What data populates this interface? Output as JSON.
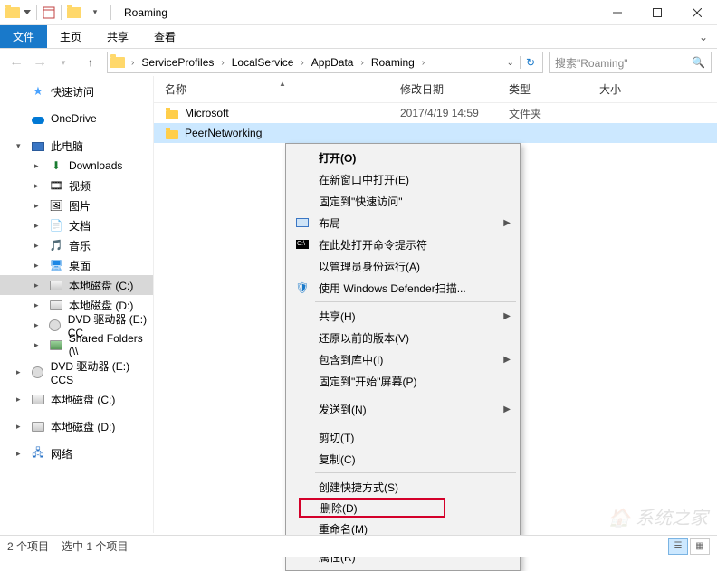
{
  "title": "Roaming",
  "ribbon": {
    "file": "文件",
    "home": "主页",
    "share": "共享",
    "view": "查看"
  },
  "breadcrumb": [
    "ServiceProfiles",
    "LocalService",
    "AppData",
    "Roaming"
  ],
  "search": {
    "placeholder": "搜索\"Roaming\""
  },
  "columns": {
    "name": "名称",
    "date": "修改日期",
    "type": "类型",
    "size": "大小"
  },
  "rows": [
    {
      "name": "Microsoft",
      "date": "2017/4/19 14:59",
      "type": "文件夹"
    },
    {
      "name": "PeerNetworking",
      "date": "",
      "type": ""
    }
  ],
  "sidebar": {
    "quick": "快速访问",
    "onedrive": "OneDrive",
    "thispc": "此电脑",
    "downloads": "Downloads",
    "videos": "视频",
    "pictures": "图片",
    "documents": "文档",
    "music": "音乐",
    "desktop": "桌面",
    "diskC": "本地磁盘 (C:)",
    "diskD": "本地磁盘 (D:)",
    "dvdE": "DVD 驱动器 (E:) CC",
    "shared": "Shared Folders (\\\\",
    "dvdE2": "DVD 驱动器 (E:) CCS",
    "diskC2": "本地磁盘 (C:)",
    "diskD2": "本地磁盘 (D:)",
    "network": "网络"
  },
  "ctx": {
    "open": "打开(O)",
    "openNew": "在新窗口中打开(E)",
    "pinQuick": "固定到\"快速访问\"",
    "layout": "布局",
    "cmdHere": "在此处打开命令提示符",
    "runAdmin": "以管理员身份运行(A)",
    "defender": "使用 Windows Defender扫描...",
    "share": "共享(H)",
    "restore": "还原以前的版本(V)",
    "library": "包含到库中(I)",
    "pinStart": "固定到\"开始\"屏幕(P)",
    "sendTo": "发送到(N)",
    "cut": "剪切(T)",
    "copy": "复制(C)",
    "shortcut": "创建快捷方式(S)",
    "delete": "删除(D)",
    "rename": "重命名(M)",
    "props": "属性(R)"
  },
  "status": {
    "count": "2 个项目",
    "selected": "选中 1 个项目"
  },
  "watermark": "系统之家"
}
